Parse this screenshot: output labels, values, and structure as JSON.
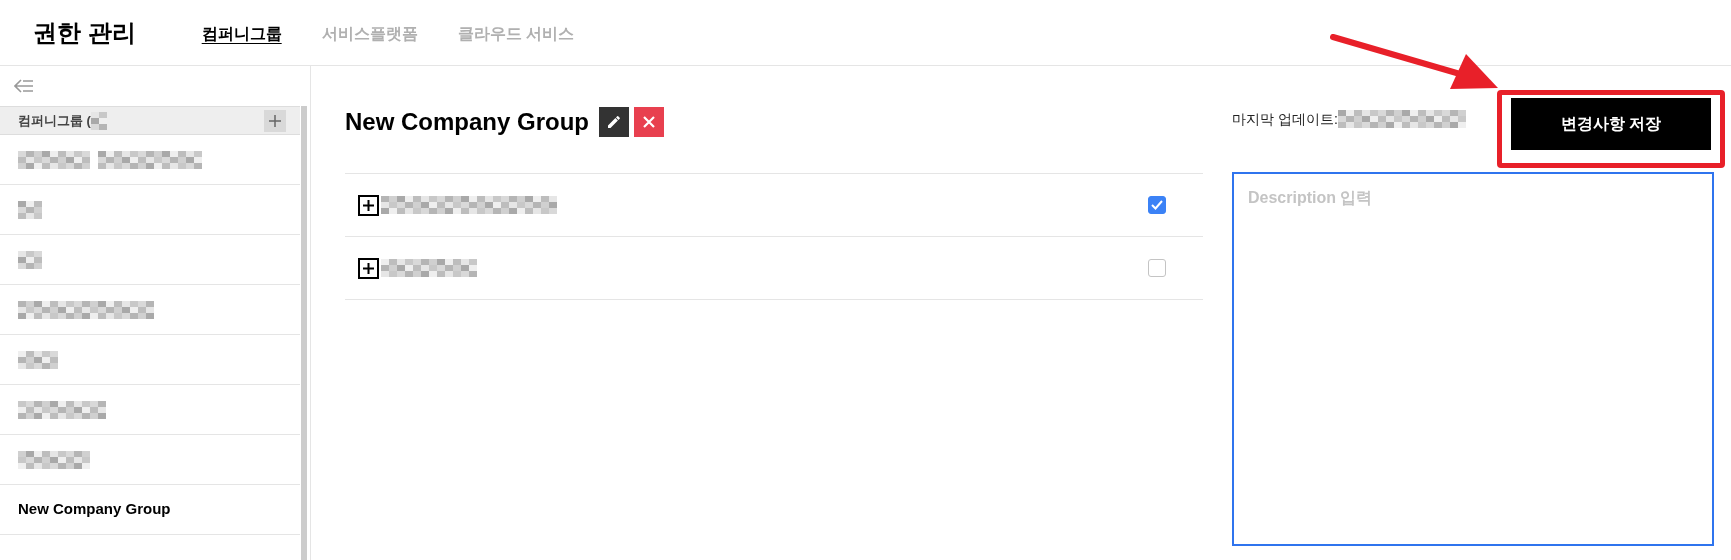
{
  "header": {
    "title": "권한 관리",
    "tabs": [
      {
        "label": "컴퍼니그룹",
        "selected": true
      },
      {
        "label": "서비스플랫폼",
        "selected": false
      },
      {
        "label": "클라우드 서비스",
        "selected": false
      }
    ]
  },
  "sidebar": {
    "section_label": "컴퍼니그룹 (",
    "items": [
      {
        "kind": "redacted",
        "selected": false
      },
      {
        "kind": "redacted",
        "selected": false
      },
      {
        "kind": "redacted",
        "selected": false
      },
      {
        "kind": "redacted",
        "selected": false
      },
      {
        "kind": "redacted",
        "selected": false
      },
      {
        "kind": "redacted",
        "selected": false
      },
      {
        "kind": "redacted",
        "selected": false
      },
      {
        "kind": "text",
        "label": "New Company Group",
        "selected": true
      }
    ]
  },
  "main": {
    "title": "New Company Group",
    "rows": [
      {
        "kind": "redacted",
        "checked": true
      },
      {
        "kind": "redacted",
        "checked": false
      }
    ],
    "last_update_label": "마지막 업데이트:",
    "save_button": "변경사항 저장",
    "description": {
      "placeholder": "Description 입력"
    }
  }
}
